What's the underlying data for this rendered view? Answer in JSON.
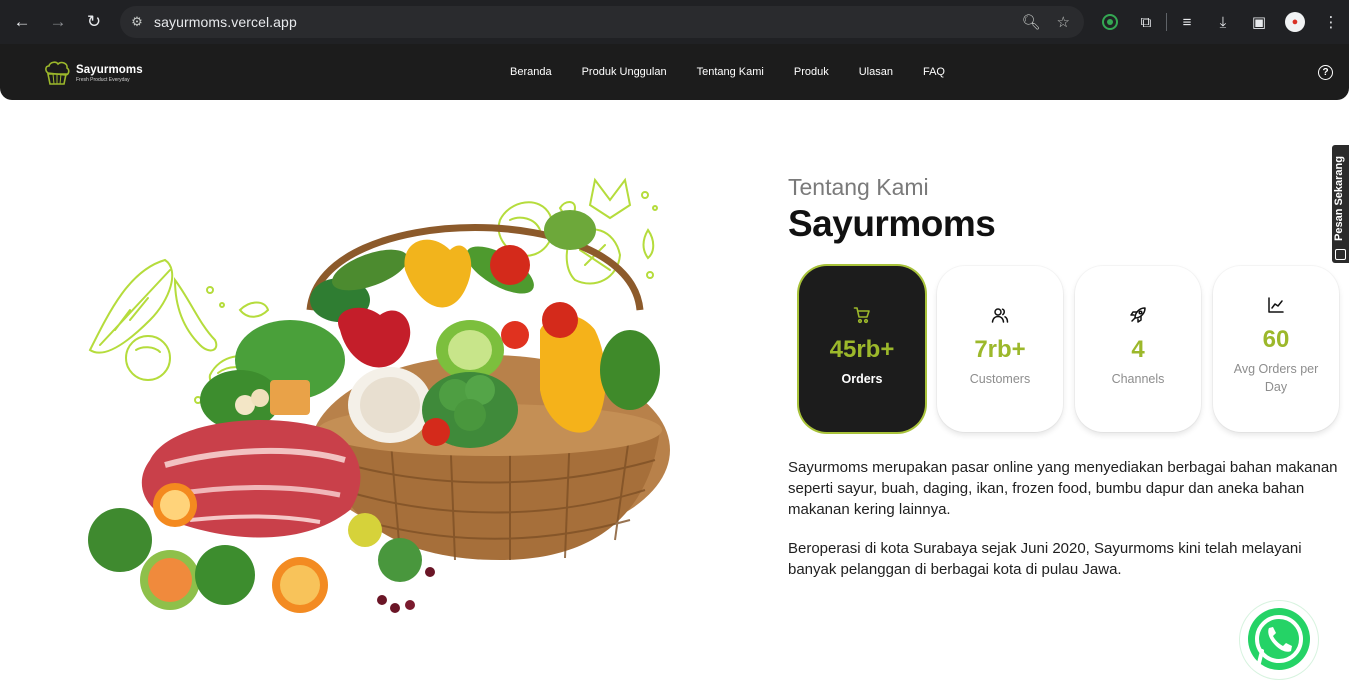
{
  "browser": {
    "url": "sayurmoms.vercel.app"
  },
  "navbar": {
    "brand_name": "Sayurmoms",
    "brand_tagline": "Fresh Product Everyday",
    "links": [
      "Beranda",
      "Produk Unggulan",
      "Tentang Kami",
      "Produk",
      "Ulasan",
      "FAQ"
    ]
  },
  "about": {
    "subtitle": "Tentang Kami",
    "title": "Sayurmoms",
    "stats": [
      {
        "icon": "cart-icon",
        "value": "45rb+",
        "label": "Orders"
      },
      {
        "icon": "users-icon",
        "value": "7rb+",
        "label": "Customers"
      },
      {
        "icon": "rocket-icon",
        "value": "4",
        "label": "Channels"
      },
      {
        "icon": "chart-line-icon",
        "value": "60",
        "label": "Avg Orders per Day"
      }
    ],
    "paragraph_1": "Sayurmoms merupakan pasar online yang menyediakan berbagai bahan makanan seperti sayur, buah, daging, ikan, frozen food, bumbu dapur dan aneka bahan makanan kering lainnya.",
    "paragraph_2": "Beroperasi di kota Surabaya sejak Juni 2020, Sayurmoms kini telah melayani banyak pelanggan di berbagai kota di pulau Jawa."
  },
  "side_tab": {
    "label": "Pesan Sekarang"
  },
  "colors": {
    "accent": "#9cb82b",
    "nav_bg": "#1c1c1c",
    "whatsapp": "#25d366"
  }
}
